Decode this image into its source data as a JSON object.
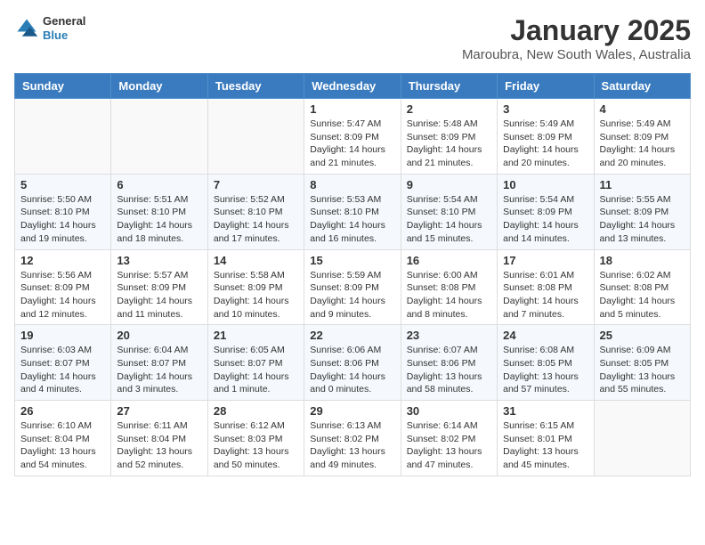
{
  "header": {
    "logo": {
      "general": "General",
      "blue": "Blue"
    },
    "title": "January 2025",
    "location": "Maroubra, New South Wales, Australia"
  },
  "weekdays": [
    "Sunday",
    "Monday",
    "Tuesday",
    "Wednesday",
    "Thursday",
    "Friday",
    "Saturday"
  ],
  "weeks": [
    [
      {
        "day": "",
        "info": ""
      },
      {
        "day": "",
        "info": ""
      },
      {
        "day": "",
        "info": ""
      },
      {
        "day": "1",
        "info": "Sunrise: 5:47 AM\nSunset: 8:09 PM\nDaylight: 14 hours\nand 21 minutes."
      },
      {
        "day": "2",
        "info": "Sunrise: 5:48 AM\nSunset: 8:09 PM\nDaylight: 14 hours\nand 21 minutes."
      },
      {
        "day": "3",
        "info": "Sunrise: 5:49 AM\nSunset: 8:09 PM\nDaylight: 14 hours\nand 20 minutes."
      },
      {
        "day": "4",
        "info": "Sunrise: 5:49 AM\nSunset: 8:09 PM\nDaylight: 14 hours\nand 20 minutes."
      }
    ],
    [
      {
        "day": "5",
        "info": "Sunrise: 5:50 AM\nSunset: 8:10 PM\nDaylight: 14 hours\nand 19 minutes."
      },
      {
        "day": "6",
        "info": "Sunrise: 5:51 AM\nSunset: 8:10 PM\nDaylight: 14 hours\nand 18 minutes."
      },
      {
        "day": "7",
        "info": "Sunrise: 5:52 AM\nSunset: 8:10 PM\nDaylight: 14 hours\nand 17 minutes."
      },
      {
        "day": "8",
        "info": "Sunrise: 5:53 AM\nSunset: 8:10 PM\nDaylight: 14 hours\nand 16 minutes."
      },
      {
        "day": "9",
        "info": "Sunrise: 5:54 AM\nSunset: 8:10 PM\nDaylight: 14 hours\nand 15 minutes."
      },
      {
        "day": "10",
        "info": "Sunrise: 5:54 AM\nSunset: 8:09 PM\nDaylight: 14 hours\nand 14 minutes."
      },
      {
        "day": "11",
        "info": "Sunrise: 5:55 AM\nSunset: 8:09 PM\nDaylight: 14 hours\nand 13 minutes."
      }
    ],
    [
      {
        "day": "12",
        "info": "Sunrise: 5:56 AM\nSunset: 8:09 PM\nDaylight: 14 hours\nand 12 minutes."
      },
      {
        "day": "13",
        "info": "Sunrise: 5:57 AM\nSunset: 8:09 PM\nDaylight: 14 hours\nand 11 minutes."
      },
      {
        "day": "14",
        "info": "Sunrise: 5:58 AM\nSunset: 8:09 PM\nDaylight: 14 hours\nand 10 minutes."
      },
      {
        "day": "15",
        "info": "Sunrise: 5:59 AM\nSunset: 8:09 PM\nDaylight: 14 hours\nand 9 minutes."
      },
      {
        "day": "16",
        "info": "Sunrise: 6:00 AM\nSunset: 8:08 PM\nDaylight: 14 hours\nand 8 minutes."
      },
      {
        "day": "17",
        "info": "Sunrise: 6:01 AM\nSunset: 8:08 PM\nDaylight: 14 hours\nand 7 minutes."
      },
      {
        "day": "18",
        "info": "Sunrise: 6:02 AM\nSunset: 8:08 PM\nDaylight: 14 hours\nand 5 minutes."
      }
    ],
    [
      {
        "day": "19",
        "info": "Sunrise: 6:03 AM\nSunset: 8:07 PM\nDaylight: 14 hours\nand 4 minutes."
      },
      {
        "day": "20",
        "info": "Sunrise: 6:04 AM\nSunset: 8:07 PM\nDaylight: 14 hours\nand 3 minutes."
      },
      {
        "day": "21",
        "info": "Sunrise: 6:05 AM\nSunset: 8:07 PM\nDaylight: 14 hours\nand 1 minute."
      },
      {
        "day": "22",
        "info": "Sunrise: 6:06 AM\nSunset: 8:06 PM\nDaylight: 14 hours\nand 0 minutes."
      },
      {
        "day": "23",
        "info": "Sunrise: 6:07 AM\nSunset: 8:06 PM\nDaylight: 13 hours\nand 58 minutes."
      },
      {
        "day": "24",
        "info": "Sunrise: 6:08 AM\nSunset: 8:05 PM\nDaylight: 13 hours\nand 57 minutes."
      },
      {
        "day": "25",
        "info": "Sunrise: 6:09 AM\nSunset: 8:05 PM\nDaylight: 13 hours\nand 55 minutes."
      }
    ],
    [
      {
        "day": "26",
        "info": "Sunrise: 6:10 AM\nSunset: 8:04 PM\nDaylight: 13 hours\nand 54 minutes."
      },
      {
        "day": "27",
        "info": "Sunrise: 6:11 AM\nSunset: 8:04 PM\nDaylight: 13 hours\nand 52 minutes."
      },
      {
        "day": "28",
        "info": "Sunrise: 6:12 AM\nSunset: 8:03 PM\nDaylight: 13 hours\nand 50 minutes."
      },
      {
        "day": "29",
        "info": "Sunrise: 6:13 AM\nSunset: 8:02 PM\nDaylight: 13 hours\nand 49 minutes."
      },
      {
        "day": "30",
        "info": "Sunrise: 6:14 AM\nSunset: 8:02 PM\nDaylight: 13 hours\nand 47 minutes."
      },
      {
        "day": "31",
        "info": "Sunrise: 6:15 AM\nSunset: 8:01 PM\nDaylight: 13 hours\nand 45 minutes."
      },
      {
        "day": "",
        "info": ""
      }
    ]
  ]
}
